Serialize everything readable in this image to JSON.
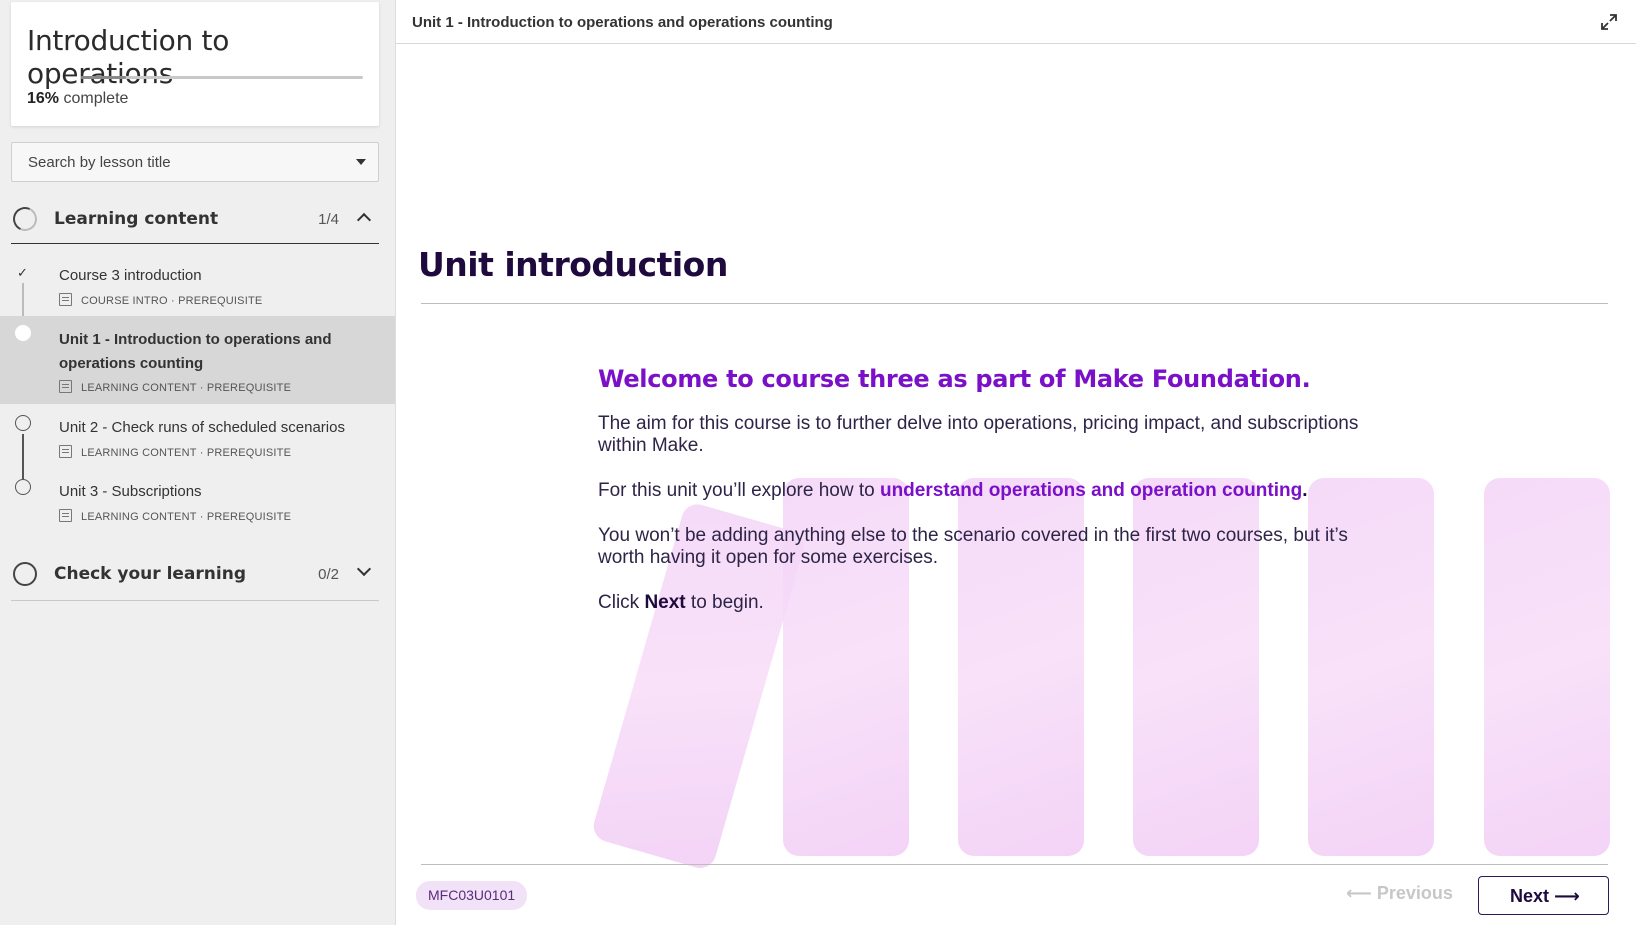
{
  "sidebar": {
    "course_title": "Introduction to operations",
    "progress": {
      "percent": 16,
      "percent_label": "16%",
      "suffix": "complete"
    },
    "search": {
      "placeholder": "Search by lesson title"
    },
    "sections": [
      {
        "label": "Learning content",
        "count": "1/4",
        "expanded": true,
        "lessons": [
          {
            "title": "Course 3 introduction",
            "meta": "COURSE INTRO · PREREQUISITE",
            "status": "completed"
          },
          {
            "title": "Unit 1 - Introduction to operations and operations counting",
            "meta": "LEARNING CONTENT · PREREQUISITE",
            "status": "current"
          },
          {
            "title": "Unit 2 - Check runs of scheduled scenarios",
            "meta": "LEARNING CONTENT · PREREQUISITE",
            "status": "not-started"
          },
          {
            "title": "Unit 3 - Subscriptions",
            "meta": "LEARNING CONTENT · PREREQUISITE",
            "status": "not-started"
          }
        ]
      },
      {
        "label": "Check your learning",
        "count": "0/2",
        "expanded": false
      }
    ]
  },
  "main": {
    "breadcrumb": "Unit 1 - Introduction to operations and operations counting",
    "heading": "Unit introduction",
    "welcome": "Welcome to course three as part of Make Foundation.",
    "para1": "The aim for this course is to further delve into operations, pricing impact, and subscriptions within Make.",
    "para2_prefix": "For this unit you’ll explore how to ",
    "para2_highlight": "understand operations and operation counting",
    "para2_suffix": ".",
    "para3": "You won’t be adding anything else to the scenario covered in the first two courses, but it’s worth having it open for some exercises.",
    "para4_prefix": "Click ",
    "para4_bold": "Next",
    "para4_suffix": " to begin.",
    "code": "MFC03U0101",
    "previous_label": "Previous",
    "next_label": "Next"
  },
  "colors": {
    "accent": "#7b10c9",
    "heading": "#1e0a3c",
    "pillar": "#f3d4f7"
  },
  "icons": [
    "chevron-up-icon",
    "chevron-down-icon",
    "caret-down-icon",
    "check-icon",
    "document-icon",
    "expand-icon",
    "arrow-left-icon",
    "arrow-right-icon"
  ]
}
